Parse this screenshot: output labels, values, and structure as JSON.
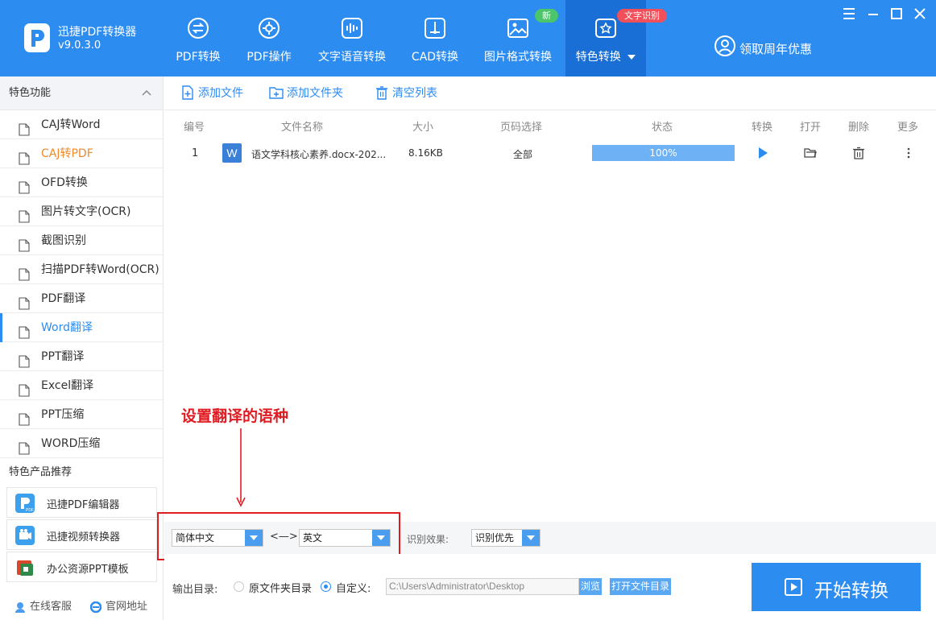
{
  "app": {
    "name": "迅捷PDF转换器",
    "version": "v9.0.3.0"
  },
  "nav": {
    "tabs": [
      {
        "label": "PDF转换",
        "icon": "swap-circle-icon"
      },
      {
        "label": "PDF操作",
        "icon": "gear-circle-icon"
      },
      {
        "label": "文字语音转换",
        "icon": "audio-wave-icon"
      },
      {
        "label": "CAD转换",
        "icon": "cad-icon"
      },
      {
        "label": "图片格式转换",
        "icon": "image-icon",
        "badge": "新"
      },
      {
        "label": "特色转换",
        "icon": "star-swap-icon",
        "badge": "文字识别",
        "active": true
      }
    ],
    "promo": "领取周年优惠"
  },
  "sidebar": {
    "section_title": "特色功能",
    "items": [
      {
        "label": "CAJ转Word"
      },
      {
        "label": "CAJ转PDF",
        "state": "highlighted"
      },
      {
        "label": "OFD转换"
      },
      {
        "label": "图片转文字(OCR)"
      },
      {
        "label": "截图识别"
      },
      {
        "label": "扫描PDF转Word(OCR)"
      },
      {
        "label": "PDF翻译"
      },
      {
        "label": "Word翻译",
        "state": "active"
      },
      {
        "label": "PPT翻译"
      },
      {
        "label": "Excel翻译"
      },
      {
        "label": "PPT压缩"
      },
      {
        "label": "WORD压缩"
      }
    ],
    "recommend_title": "特色产品推荐",
    "recommend": [
      {
        "label": "迅捷PDF编辑器"
      },
      {
        "label": "迅捷视频转换器"
      },
      {
        "label": "办公资源PPT模板"
      }
    ],
    "footer": {
      "service": "在线客服",
      "website": "官网地址"
    }
  },
  "toolbar": {
    "add_file": "添加文件",
    "add_folder": "添加文件夹",
    "clear_list": "清空列表"
  },
  "table": {
    "headers": [
      "编号",
      "文件名称",
      "大小",
      "页码选择",
      "状态",
      "转换",
      "打开",
      "删除",
      "更多"
    ],
    "rows": [
      {
        "index": "1",
        "file_icon": "W",
        "name": "语文学科核心素养.docx-202...",
        "size": "8.16KB",
        "pages": "全部",
        "progress": 100,
        "progress_text": "100%"
      }
    ]
  },
  "annotation": {
    "text": "设置翻译的语种"
  },
  "options": {
    "source_lang": "简体中文",
    "swap": "<—>",
    "target_lang": "英文",
    "recog_label": "识别效果:",
    "recog_value": "识别优先"
  },
  "output": {
    "label": "输出目录:",
    "option_original": "原文件夹目录",
    "option_custom": "自定义:",
    "selected": "custom",
    "path": "C:\\Users\\Administrator\\Desktop",
    "browse": "浏览",
    "open_folder": "打开文件目录",
    "start": "开始转换"
  },
  "colors": {
    "primary": "#2d8cf0",
    "active_tab": "#1a6fd6",
    "highlight": "#f08a2c",
    "annotation": "#e11b22"
  }
}
